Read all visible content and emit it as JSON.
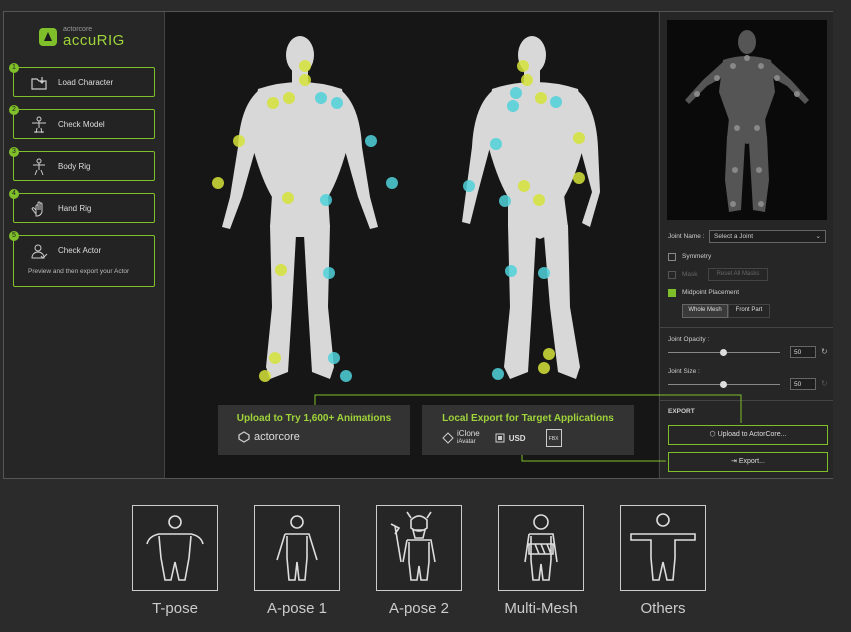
{
  "logo": {
    "sub": "actorcore",
    "main": "accuRIG"
  },
  "steps": [
    {
      "num": "1",
      "label": "Load Character",
      "icon": "folder-upload-icon"
    },
    {
      "num": "2",
      "label": "Check Model",
      "icon": "tpose-figure-icon"
    },
    {
      "num": "3",
      "label": "Body Rig",
      "icon": "body-figure-icon"
    },
    {
      "num": "4",
      "label": "Hand Rig",
      "icon": "hand-icon"
    },
    {
      "num": "5",
      "label": "Check Actor",
      "icon": "user-check-icon",
      "sub": "Preview and then export your Actor"
    }
  ],
  "banners": {
    "upload": {
      "title": "Upload to Try 1,600+ Animations",
      "brand": "actorcore"
    },
    "export": {
      "title": "Local Export for Target Applications",
      "iclone": "iClone",
      "iavatar": "iAvatar",
      "usd": "USD",
      "fbx": "FBX"
    }
  },
  "right": {
    "joint_name_label": "Joint Name :",
    "joint_select": "Select a Joint",
    "symmetry": "Symmetry",
    "mask": "Mask",
    "reset_masks": "Reset All Masks",
    "midpoint": "Midpoint Placement",
    "whole_mesh": "Whole Mesh",
    "front_part": "Front Part",
    "joint_opacity_label": "Joint Opacity :",
    "joint_opacity_value": "50",
    "joint_size_label": "Joint Size :",
    "joint_size_value": "50",
    "export_label": "EXPORT",
    "upload_btn": "Upload to ActorCore...",
    "export_btn": "Export..."
  },
  "poses": [
    "T-pose",
    "A-pose 1",
    "A-pose 2",
    "Multi-Mesh",
    "Others"
  ],
  "colors": {
    "accent": "#7fbf2a",
    "joint_yellow": "#d6e33a",
    "joint_cyan": "#4fd1d9"
  }
}
